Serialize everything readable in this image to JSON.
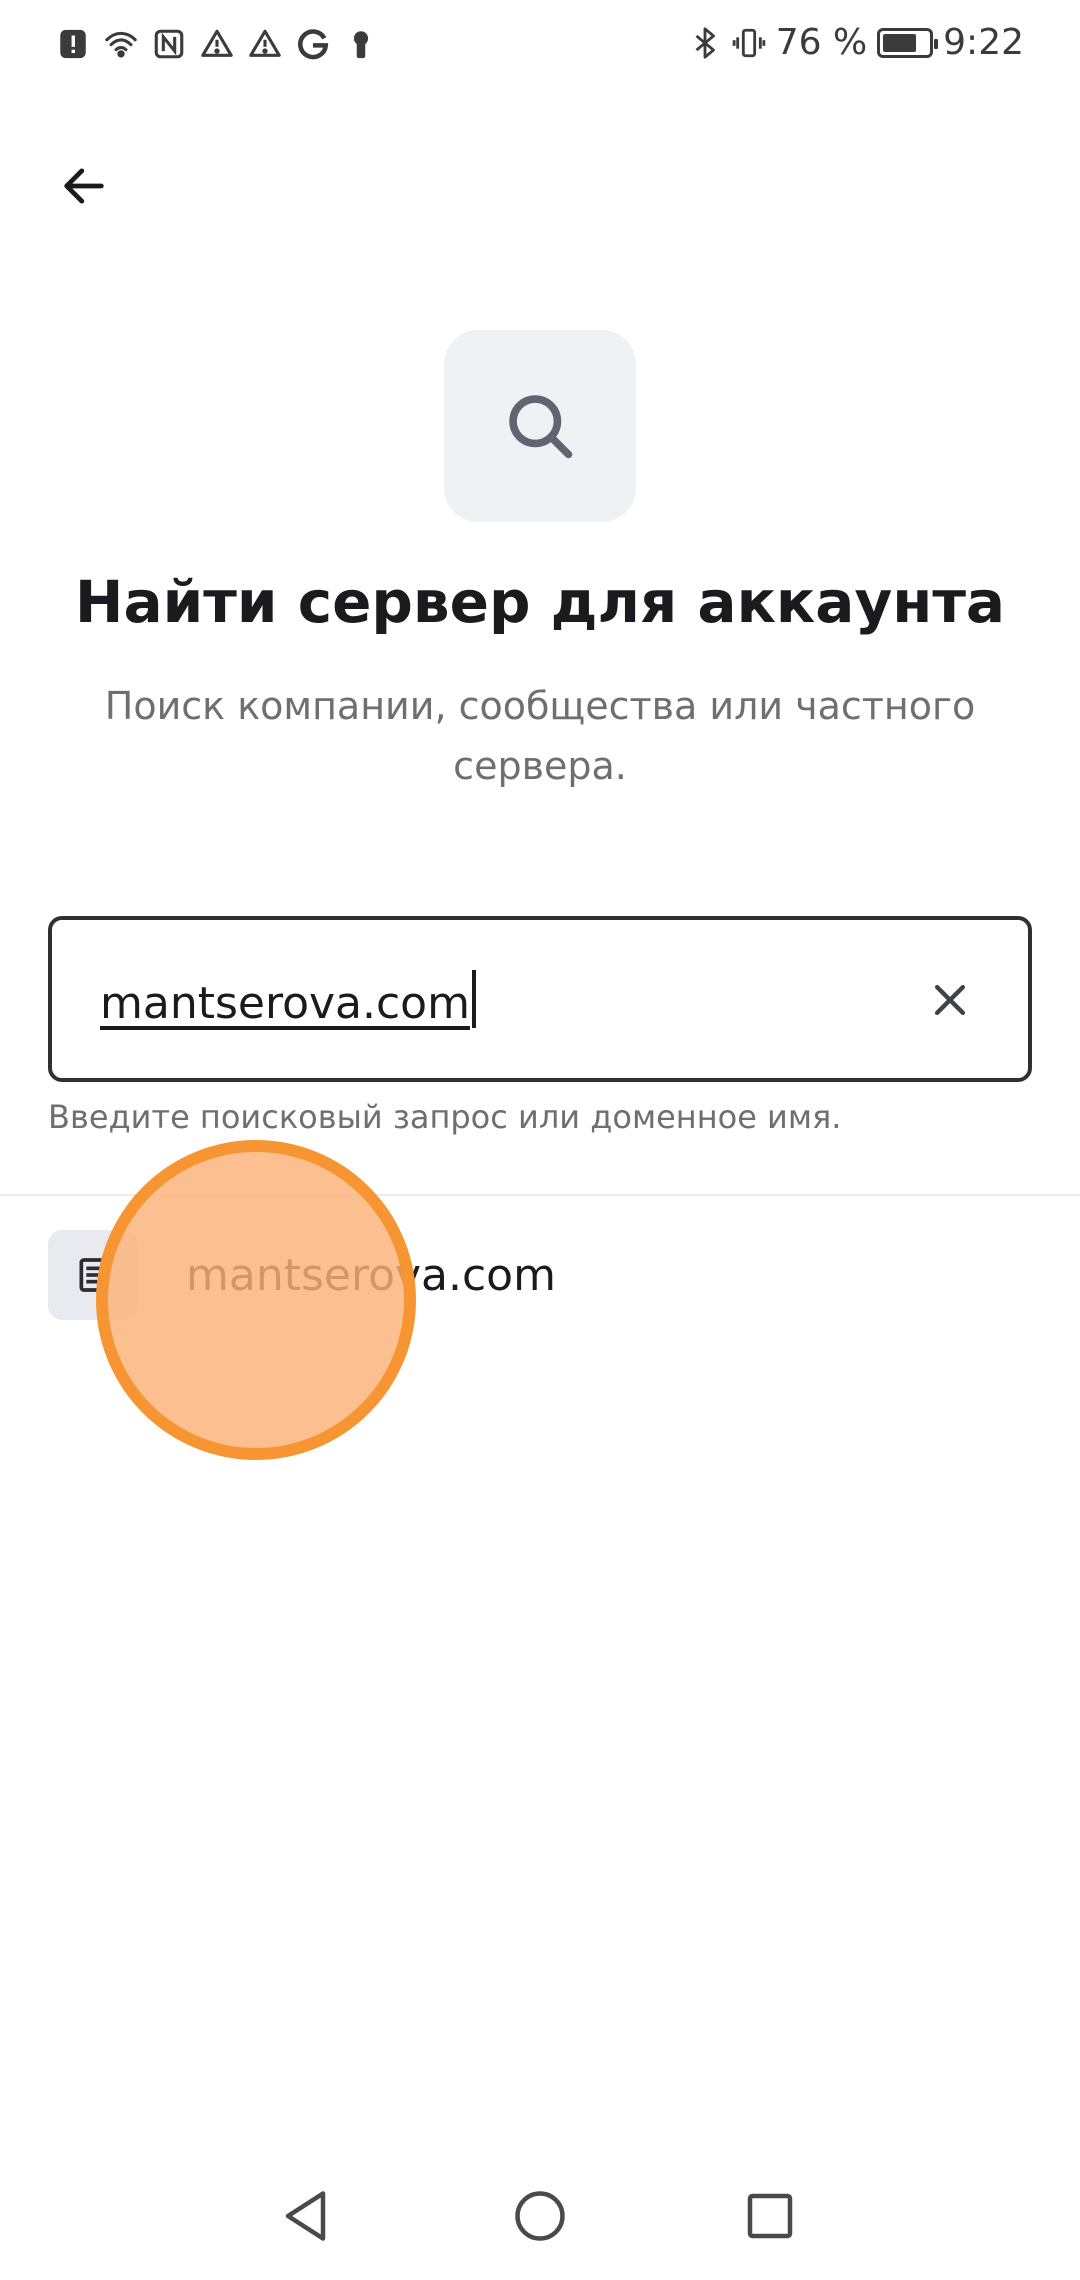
{
  "status_bar": {
    "battery_percent": "76 %",
    "time": "9:22",
    "battery_level": 0.76,
    "left_icons": [
      "alert-icon",
      "wifi-icon",
      "nfc-icon",
      "warning-icon",
      "warning-icon",
      "google-icon",
      "keyhole-icon"
    ],
    "right_icons": [
      "bluetooth-icon",
      "vibrate-icon",
      "battery-icon"
    ]
  },
  "header": {
    "back_icon": "arrow-left-icon"
  },
  "hero": {
    "icon": "search-icon",
    "title": "Найти сервер для аккаунта",
    "subtitle": "Поиск компании, сообщества или частного сервера."
  },
  "search": {
    "value": "mantserova.com",
    "helper": "Введите поисковый запрос или доменное имя.",
    "clear_icon": "close-icon"
  },
  "results": [
    {
      "label": "mantserova.com",
      "icon": "server-icon"
    }
  ],
  "nav_bar": {
    "buttons": [
      "back-triangle-icon",
      "home-circle-icon",
      "recents-square-icon"
    ]
  },
  "colors": {
    "accent_touch": "#f79533",
    "text_primary": "#1b1b1f",
    "text_secondary": "#6e6e73",
    "tile_bg": "#f0f1f4"
  }
}
